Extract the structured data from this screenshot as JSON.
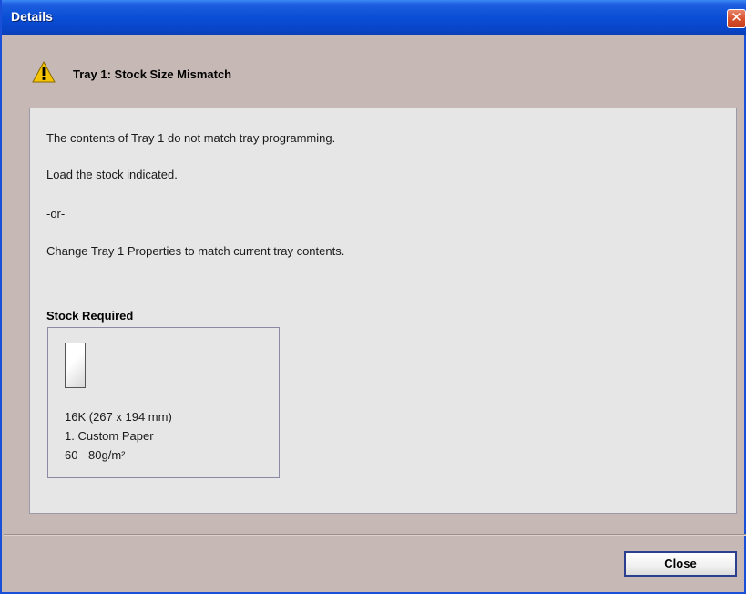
{
  "window": {
    "title": "Details",
    "close_glyph": "✕"
  },
  "header": {
    "icon": "warning-icon",
    "title": "Tray 1: Stock Size Mismatch"
  },
  "messages": [
    "The contents of Tray 1 do not match tray programming.",
    "Load the stock indicated.",
    "-or-",
    "Change Tray 1 Properties to match current tray contents."
  ],
  "stock": {
    "label": "Stock Required",
    "icon": "paper-icon",
    "size": "16K (267 x 194 mm)",
    "type": "1. Custom Paper",
    "weight": "60 - 80g/m²"
  },
  "footer": {
    "close_label": "Close"
  },
  "colors": {
    "titlebar": "#0a4ed6",
    "background": "#c6b8b4",
    "panel": "#e6e6e6",
    "warning": "#f5c400"
  }
}
